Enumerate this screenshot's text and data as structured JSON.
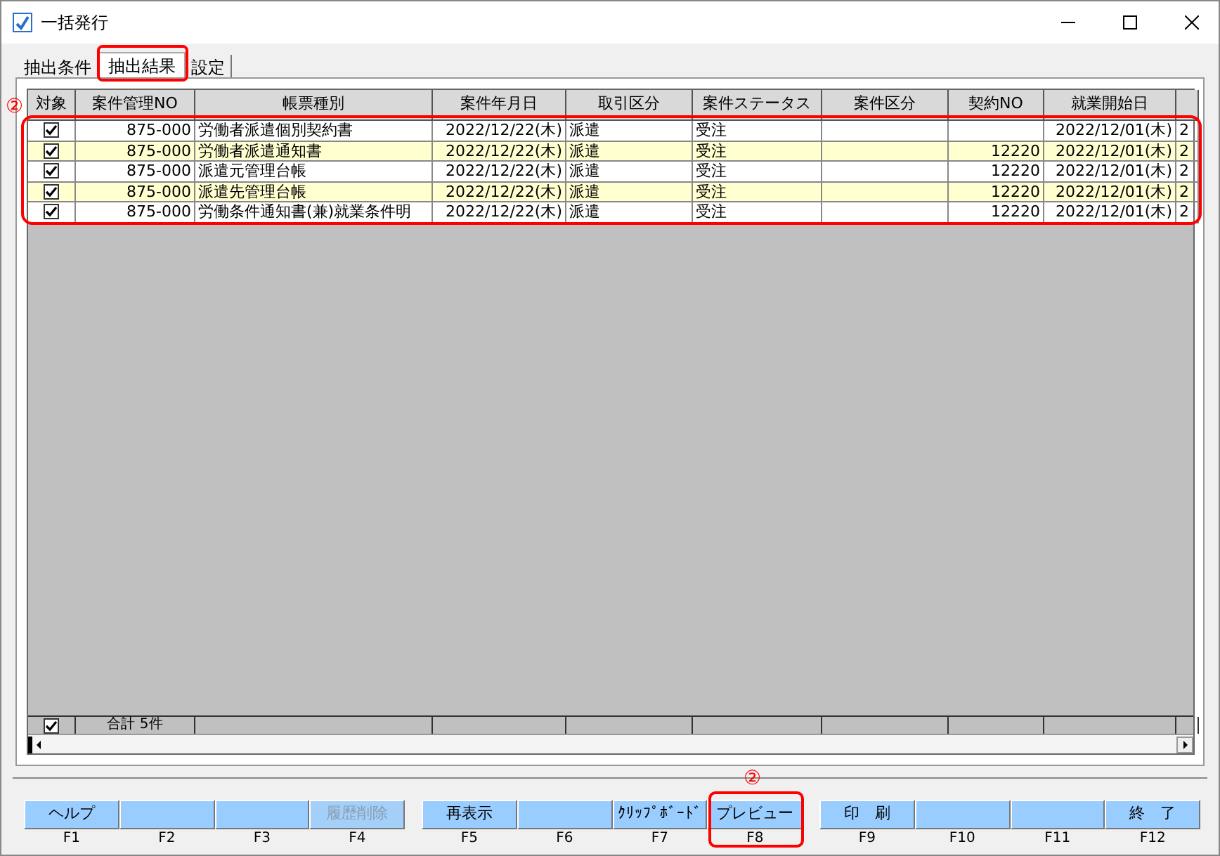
{
  "window": {
    "title": "一括発行"
  },
  "tabs": [
    {
      "label": "抽出条件",
      "selected": false
    },
    {
      "label": "抽出結果",
      "selected": true
    },
    {
      "label": "設定",
      "selected": false
    }
  ],
  "table": {
    "columns": [
      "対象",
      "案件管理NO",
      "帳票種別",
      "案件年月日",
      "取引区分",
      "案件ステータス",
      "案件区分",
      "契約NO",
      "就業開始日",
      ""
    ],
    "rows": [
      {
        "checked": true,
        "cells": [
          "",
          "875-000",
          "労働者派遣個別契約書",
          "2022/12/22(木)",
          "派遣",
          "受注",
          "",
          "",
          "2022/12/01(木)",
          "2"
        ]
      },
      {
        "checked": true,
        "cells": [
          "",
          "875-000",
          "労働者派遣通知書",
          "2022/12/22(木)",
          "派遣",
          "受注",
          "",
          "12220",
          "2022/12/01(木)",
          "2"
        ]
      },
      {
        "checked": true,
        "cells": [
          "",
          "875-000",
          "派遣元管理台帳",
          "2022/12/22(木)",
          "派遣",
          "受注",
          "",
          "12220",
          "2022/12/01(木)",
          "2"
        ]
      },
      {
        "checked": true,
        "cells": [
          "",
          "875-000",
          "派遣先管理台帳",
          "2022/12/22(木)",
          "派遣",
          "受注",
          "",
          "12220",
          "2022/12/01(木)",
          "2"
        ]
      },
      {
        "checked": true,
        "cells": [
          "",
          "875-000",
          "労働条件通知書(兼)就業条件明",
          "2022/12/22(木)",
          "派遣",
          "受注",
          "",
          "12220",
          "2022/12/01(木)",
          "2"
        ]
      }
    ],
    "footer": {
      "checked": true,
      "total": "合計 5件"
    }
  },
  "function_keys": [
    {
      "label": "ヘルプ",
      "key": "F1",
      "disabled": false
    },
    {
      "key": "F2"
    },
    {
      "key": "F3"
    },
    {
      "label": "履歴削除",
      "key": "F4",
      "disabled": true
    },
    {
      "label": "再表示",
      "key": "F5",
      "disabled": false
    },
    {
      "key": "F6"
    },
    {
      "label": "ｸﾘｯﾌﾟﾎﾞｰﾄﾞ",
      "key": "F7",
      "disabled": false
    },
    {
      "label": "プレビュー",
      "key": "F8",
      "disabled": false
    },
    {
      "label": "印　刷",
      "key": "F9",
      "disabled": false
    },
    {
      "key": "F10"
    },
    {
      "key": "F11"
    },
    {
      "label": "終　了",
      "key": "F12",
      "disabled": false
    }
  ],
  "annotations": [
    {
      "label": "②"
    },
    {
      "label": "②"
    }
  ]
}
